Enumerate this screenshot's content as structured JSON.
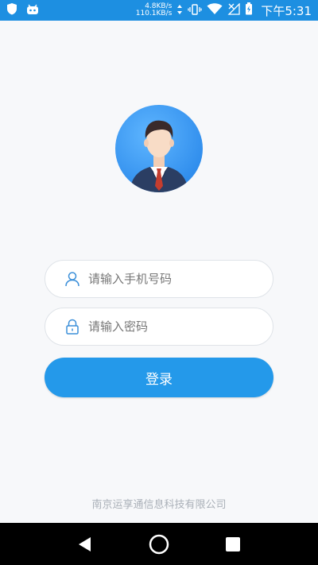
{
  "status_bar": {
    "speed_up": "4.8KB/s",
    "speed_down": "110.1KB/s",
    "time": "下午5:31",
    "icons": [
      "shield-icon",
      "android-icon",
      "updown-arrows-icon",
      "vibrate-icon",
      "wifi-icon",
      "no-signal-icon",
      "battery-charging-icon"
    ]
  },
  "login": {
    "phone_placeholder": "请输入手机号码",
    "password_placeholder": "请输入密码",
    "submit_label": "登录"
  },
  "footer": {
    "company": "南京运享通信息科技有限公司"
  },
  "nav": {
    "icons": [
      "back-icon",
      "home-icon",
      "recents-icon"
    ]
  },
  "colors": {
    "status_bar": "#1d8fe1",
    "accent": "#2499ea",
    "background": "#f7f8fa"
  }
}
